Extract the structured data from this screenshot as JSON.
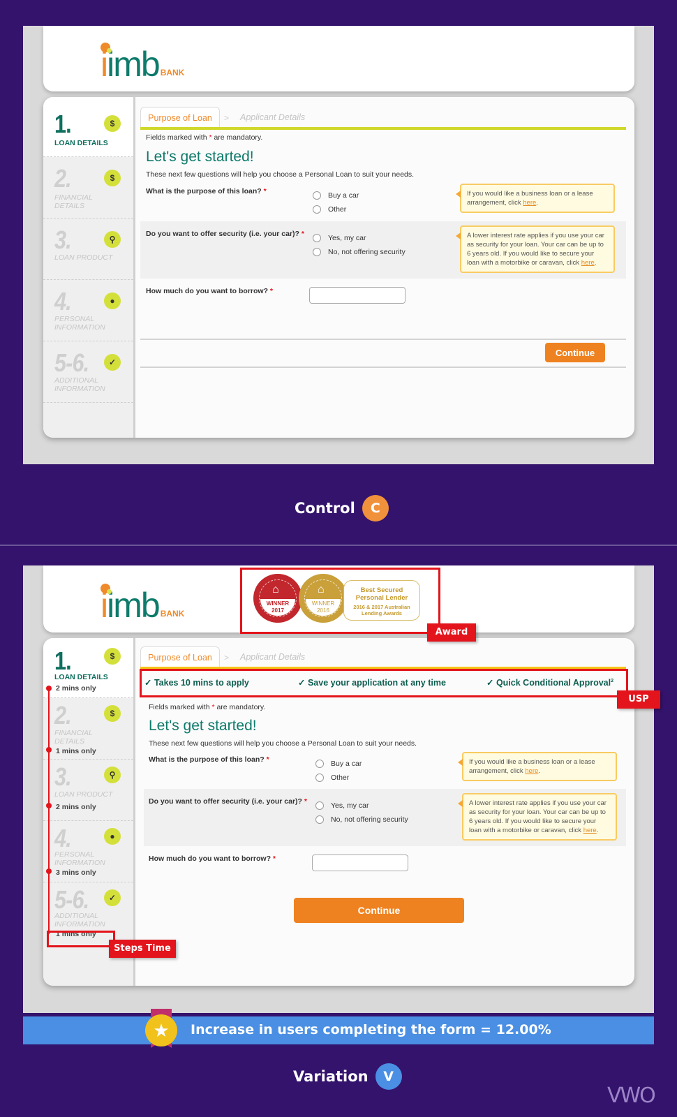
{
  "brand": {
    "logo_main": "imb",
    "logo_sub": "BANK"
  },
  "steps": [
    {
      "number": "1.",
      "label": "LOAN DETAILS",
      "icon": "clipboard-dollar-icon",
      "glyph": "$",
      "active": true
    },
    {
      "number": "2.",
      "label": "FINANCIAL DETAILS",
      "icon": "dollar-sign-pen-icon",
      "glyph": "$",
      "active": false
    },
    {
      "number": "3.",
      "label": "LOAN PRODUCT",
      "icon": "dollar-magnifier-icon",
      "glyph": "⚲",
      "active": false
    },
    {
      "number": "4.",
      "label": "PERSONAL INFORMATION",
      "icon": "clipboard-person-icon",
      "glyph": "●",
      "active": false
    },
    {
      "number": "5-6.",
      "label": "ADDITIONAL INFORMATION",
      "icon": "dollar-check-icon",
      "glyph": "✓",
      "active": false
    }
  ],
  "step_times": [
    "2 mins only",
    "1 mins only",
    "2 mins only",
    "3 mins only",
    "1 mins only"
  ],
  "tabs": {
    "active": "Purpose of Loan",
    "separator": ">",
    "inactive": "Applicant Details"
  },
  "form": {
    "mandatory_prefix": "Fields marked with",
    "mandatory_star": "*",
    "mandatory_suffix": "are mandatory.",
    "heading": "Let's get started!",
    "intro": "These next few questions will help you choose a Personal Loan to suit your needs.",
    "q1": {
      "label": "What is the purpose of this loan?",
      "options": [
        "Buy a car",
        "Other"
      ],
      "tip_text": "If you would like a business loan or a lease arrangement, click ",
      "tip_link": "here",
      "tip_end": "."
    },
    "q2": {
      "label": "Do you want to offer security (i.e. your car)?",
      "options": [
        "Yes, my car",
        "No, not offering security"
      ],
      "tip_text": "A lower interest rate applies if you use your car as security for your loan. Your car can be up to 6 years old. If you would like to secure your loan with a motorbike or caravan, click ",
      "tip_link": "here",
      "tip_end": "."
    },
    "q3": {
      "label": "How much do you want to borrow?",
      "value": ""
    },
    "continue_label": "Continue"
  },
  "usps": [
    "Takes 10 mins to apply",
    "Save your application at any time",
    "Quick Conditional Approval"
  ],
  "usp_superscript": "2",
  "award": {
    "medal1": {
      "year": "2017",
      "word": "WINNER",
      "color": "#c1272d"
    },
    "medal2": {
      "year": "2016",
      "word": "WINNER",
      "color": "#c9a03a"
    },
    "title": "Best Secured Personal Lender",
    "subtitle": "2016 & 2017 Australian Lending Awards"
  },
  "annotations": {
    "award": "Award",
    "usp": "USP",
    "steps_time": "Steps Time"
  },
  "captions": {
    "control": "Control",
    "control_badge": "C",
    "variation": "Variation",
    "variation_badge": "V"
  },
  "result": "Increase in users completing the form = 12.00%",
  "vwo_logo": "VWO",
  "colors": {
    "background": "#34136d",
    "accent_orange": "#ef8220",
    "brand_green": "#0e7b6b",
    "annotation_red": "#e3141b",
    "result_blue": "#4a8fe3"
  }
}
